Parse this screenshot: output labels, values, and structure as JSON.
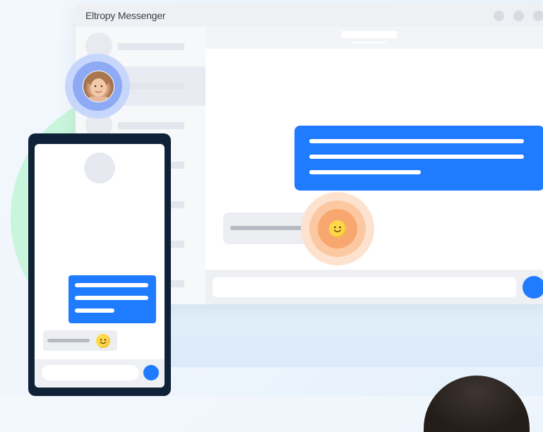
{
  "window": {
    "title": "Eltropy Messenger"
  },
  "colors": {
    "accent": "#1f7bff",
    "emoji": "#ffd84a",
    "phone_frame": "#0f2238",
    "halo_orange": "#f8a76e",
    "halo_blue": "#8eaaf5",
    "background_circle": "#c9f5dc"
  },
  "icons": {
    "emoji": "smiley-face-icon",
    "send": "send-icon",
    "avatar": "user-avatar-photo"
  }
}
